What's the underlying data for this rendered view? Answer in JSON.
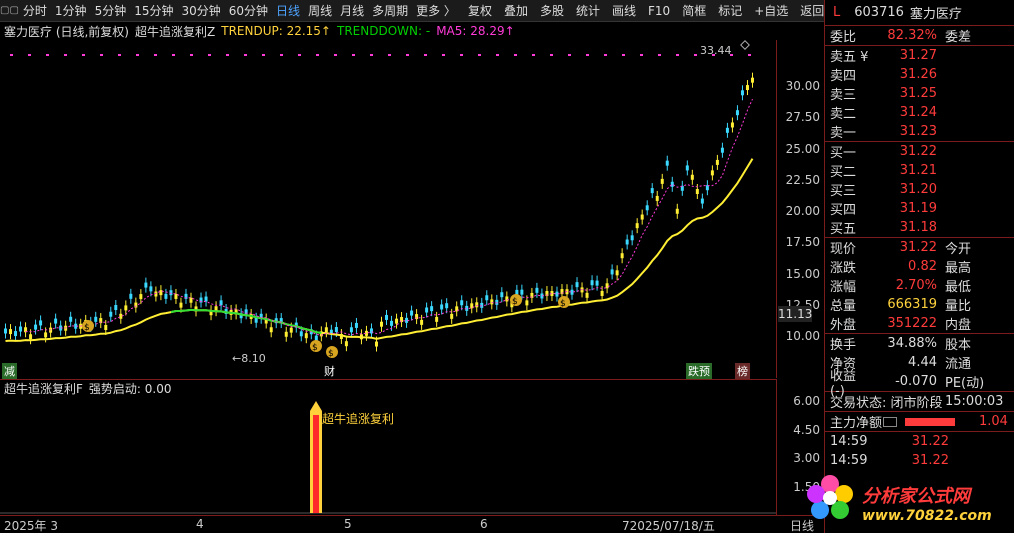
{
  "toolbar": {
    "periods": [
      "分时",
      "1分钟",
      "5分钟",
      "15分钟",
      "30分钟",
      "60分钟",
      "日线",
      "周线",
      "月线",
      "多周期",
      "更多 〉"
    ],
    "active_period": "日线",
    "tools": [
      "复权",
      "叠加",
      "多股",
      "统计",
      "画线",
      "F10",
      "简框",
      "标记",
      "+自选",
      "返回"
    ]
  },
  "chart_header": {
    "stock": "塞力医疗 (日线,前复权)",
    "indicator": "超牛追涨复利Z",
    "trendup_label": "TRENDUP: 22.15↑",
    "trenddown_label": "TRENDDOWN: -",
    "ma5_label": "MA5: 28.29↑"
  },
  "price_axis": [
    "30.00",
    "27.50",
    "25.00",
    "22.50",
    "20.00",
    "17.50",
    "15.00",
    "12.50",
    "10.00"
  ],
  "current_price_tag": "11.13",
  "annotations": {
    "high": "33.44",
    "low": "←8.10",
    "left_tag": "减",
    "cai_tag": "财",
    "diefei_tag": "跌预",
    "bang_tag": "榜"
  },
  "sub_header": {
    "indicator": "超牛追涨复利F",
    "signal": "强势启动: 0.00"
  },
  "sub_axis": [
    "6.00",
    "4.50",
    "3.00",
    "1.50"
  ],
  "sub_signal_label": "超牛追涨复利",
  "date_axis": {
    "labels": [
      "2025年 3",
      "4",
      "5",
      "6",
      "72025/07/18/五"
    ],
    "right_label": "日线"
  },
  "right_panel": {
    "code": "603716",
    "name": "塞力医疗",
    "weibi_label": "委比",
    "weibi_value": "82.32%",
    "weicha_label": "委差",
    "asks": [
      {
        "label": "卖五 ¥",
        "price": "31.27"
      },
      {
        "label": "卖四",
        "price": "31.26"
      },
      {
        "label": "卖三",
        "price": "31.25"
      },
      {
        "label": "卖二",
        "price": "31.24"
      },
      {
        "label": "卖一",
        "price": "31.23"
      }
    ],
    "bids": [
      {
        "label": "买一",
        "price": "31.22"
      },
      {
        "label": "买二",
        "price": "31.21"
      },
      {
        "label": "买三",
        "price": "31.20"
      },
      {
        "label": "买四",
        "price": "31.19"
      },
      {
        "label": "买五",
        "price": "31.18"
      }
    ],
    "stats": [
      {
        "l1": "现价",
        "v": "31.22",
        "l2": "今开",
        "cls": "red"
      },
      {
        "l1": "涨跌",
        "v": "0.82",
        "l2": "最高",
        "cls": "red"
      },
      {
        "l1": "涨幅",
        "v": "2.70%",
        "l2": "最低",
        "cls": "red"
      },
      {
        "l1": "总量",
        "v": "666319",
        "l2": "量比",
        "cls": "yellow"
      },
      {
        "l1": "外盘",
        "v": "351222",
        "l2": "内盘",
        "cls": "red"
      }
    ],
    "stats2": [
      {
        "l1": "换手",
        "v": "34.88%",
        "l2": "股本",
        "cls": "white"
      },
      {
        "l1": "净资",
        "v": "4.44",
        "l2": "流通",
        "cls": "white"
      },
      {
        "l1": "收益(-)",
        "v": "-0.070",
        "l2": "PE(动)",
        "cls": "white"
      }
    ],
    "trade_state_label": "交易状态: 闭市阶段",
    "trade_time": "15:00:03",
    "main_net_label": "主力净额",
    "main_net_value": "1.04",
    "ticks": [
      {
        "time": "14:59",
        "price": "31.22"
      },
      {
        "time": "14:59",
        "price": "31.22"
      }
    ]
  },
  "logo": {
    "line1": "分析家公式网",
    "line2": "www.70822.com"
  },
  "colors": {
    "up": "#ff3b3b",
    "down": "#3bd8ff",
    "trendup": "#ffee33",
    "trenddown": "#33dd33",
    "ma5": "#ff3bd8"
  }
}
